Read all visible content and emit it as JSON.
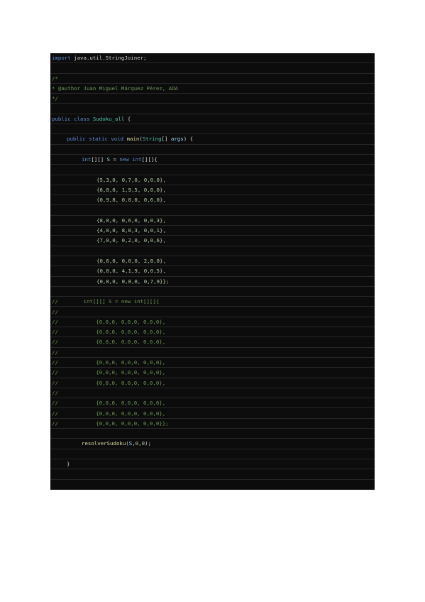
{
  "document": {
    "lines": [
      {
        "indent": 0,
        "parts": [
          {
            "t": "import",
            "c": "kw"
          },
          {
            "t": " ",
            "c": "pl"
          },
          {
            "t": "java.util.StringJoiner;",
            "c": "pl"
          }
        ]
      },
      {
        "indent": 0,
        "parts": []
      },
      {
        "indent": 0,
        "parts": [
          {
            "t": "/*",
            "c": "cm"
          }
        ]
      },
      {
        "indent": 0,
        "parts": [
          {
            "t": "* @author Juan Miguel Márquez Pérez, ADA",
            "c": "cm"
          }
        ]
      },
      {
        "indent": 0,
        "parts": [
          {
            "t": "*/",
            "c": "cm"
          }
        ]
      },
      {
        "indent": 0,
        "parts": []
      },
      {
        "indent": 0,
        "parts": [
          {
            "t": "public",
            "c": "kw"
          },
          {
            "t": " ",
            "c": "pl"
          },
          {
            "t": "class",
            "c": "kw"
          },
          {
            "t": " ",
            "c": "pl"
          },
          {
            "t": "Sudoku_all",
            "c": "ty"
          },
          {
            "t": " {",
            "c": "pl"
          }
        ]
      },
      {
        "indent": 0,
        "parts": []
      },
      {
        "indent": 1,
        "parts": [
          {
            "t": "public",
            "c": "kw"
          },
          {
            "t": " ",
            "c": "pl"
          },
          {
            "t": "static",
            "c": "kw"
          },
          {
            "t": " ",
            "c": "pl"
          },
          {
            "t": "void",
            "c": "kw"
          },
          {
            "t": " ",
            "c": "pl"
          },
          {
            "t": "main",
            "c": "fn"
          },
          {
            "t": "(",
            "c": "pl"
          },
          {
            "t": "String",
            "c": "ty"
          },
          {
            "t": "[] ",
            "c": "pl"
          },
          {
            "t": "args",
            "c": "pa"
          },
          {
            "t": ") {",
            "c": "pl"
          }
        ]
      },
      {
        "indent": 0,
        "parts": []
      },
      {
        "indent": 2,
        "parts": [
          {
            "t": "int",
            "c": "kw"
          },
          {
            "t": "[][] ",
            "c": "pl"
          },
          {
            "t": "S",
            "c": "pa"
          },
          {
            "t": " = ",
            "c": "pl"
          },
          {
            "t": "new",
            "c": "kw"
          },
          {
            "t": " ",
            "c": "pl"
          },
          {
            "t": "int",
            "c": "kw"
          },
          {
            "t": "[][]{",
            "c": "pl"
          }
        ]
      },
      {
        "indent": 0,
        "parts": []
      },
      {
        "indent": 3,
        "parts": [
          {
            "t": "{5,3,0, 0,7,0, 0,0,0},",
            "c": "nu"
          }
        ]
      },
      {
        "indent": 3,
        "parts": [
          {
            "t": "{6,0,0, 1,9,5, 0,0,0},",
            "c": "nu"
          }
        ]
      },
      {
        "indent": 3,
        "parts": [
          {
            "t": "{0,9,8, 0,0,0, 0,6,0},",
            "c": "nu"
          }
        ]
      },
      {
        "indent": 0,
        "parts": []
      },
      {
        "indent": 3,
        "parts": [
          {
            "t": "{8,0,0, 0,6,0, 0,0,3},",
            "c": "nu"
          }
        ]
      },
      {
        "indent": 3,
        "parts": [
          {
            "t": "{4,0,0, 8,0,3, 0,0,1},",
            "c": "nu"
          }
        ]
      },
      {
        "indent": 3,
        "parts": [
          {
            "t": "{7,0,0, 0,2,0, 0,0,6},",
            "c": "nu"
          }
        ]
      },
      {
        "indent": 0,
        "parts": []
      },
      {
        "indent": 3,
        "parts": [
          {
            "t": "{0,6,0, 0,0,0, 2,8,0},",
            "c": "nu"
          }
        ]
      },
      {
        "indent": 3,
        "parts": [
          {
            "t": "{0,0,0, 4,1,9, 0,0,5},",
            "c": "nu"
          }
        ]
      },
      {
        "indent": 3,
        "parts": [
          {
            "t": "{0,0,0, 0,8,0, 0,7,9}};",
            "c": "nu"
          }
        ]
      },
      {
        "indent": 0,
        "parts": []
      },
      {
        "indent": 0,
        "parts": [
          {
            "t": "//        int[][] S = new int[][]{",
            "c": "cm"
          }
        ]
      },
      {
        "indent": 0,
        "parts": [
          {
            "t": "//",
            "c": "cm"
          }
        ]
      },
      {
        "indent": 0,
        "parts": [
          {
            "t": "//            {0,0,0, 0,0,0, 0,0,0},",
            "c": "cm"
          }
        ]
      },
      {
        "indent": 0,
        "parts": [
          {
            "t": "//            {0,0,0, 0,0,0, 0,0,0},",
            "c": "cm"
          }
        ]
      },
      {
        "indent": 0,
        "parts": [
          {
            "t": "//            {0,0,0, 0,0,0, 0,0,0},",
            "c": "cm"
          }
        ]
      },
      {
        "indent": 0,
        "parts": [
          {
            "t": "//",
            "c": "cm"
          }
        ]
      },
      {
        "indent": 0,
        "parts": [
          {
            "t": "//            {0,0,0, 0,0,0, 0,0,0},",
            "c": "cm"
          }
        ]
      },
      {
        "indent": 0,
        "parts": [
          {
            "t": "//            {0,0,0, 0,0,0, 0,0,0},",
            "c": "cm"
          }
        ]
      },
      {
        "indent": 0,
        "parts": [
          {
            "t": "//            {0,0,0, 0,0,0, 0,0,0},",
            "c": "cm"
          }
        ]
      },
      {
        "indent": 0,
        "parts": [
          {
            "t": "//",
            "c": "cm"
          }
        ]
      },
      {
        "indent": 0,
        "parts": [
          {
            "t": "//            {0,0,0, 0,0,0, 0,0,0},",
            "c": "cm"
          }
        ]
      },
      {
        "indent": 0,
        "parts": [
          {
            "t": "//            {0,0,0, 0,0,0, 0,0,0},",
            "c": "cm"
          }
        ]
      },
      {
        "indent": 0,
        "parts": [
          {
            "t": "//            {0,0,0, 0,0,0, 0,0,0}};",
            "c": "cm"
          }
        ]
      },
      {
        "indent": 0,
        "parts": []
      },
      {
        "indent": 2,
        "parts": [
          {
            "t": "resolverSudoku",
            "c": "fn"
          },
          {
            "t": "(",
            "c": "pl"
          },
          {
            "t": "S",
            "c": "pa"
          },
          {
            "t": ",",
            "c": "pl"
          },
          {
            "t": "0",
            "c": "nu"
          },
          {
            "t": ",",
            "c": "pl"
          },
          {
            "t": "0",
            "c": "nu"
          },
          {
            "t": ");",
            "c": "pl"
          }
        ]
      },
      {
        "indent": 0,
        "parts": []
      },
      {
        "indent": 1,
        "parts": [
          {
            "t": "}",
            "c": "pl"
          }
        ]
      },
      {
        "indent": 0,
        "parts": []
      },
      {
        "indent": 0,
        "parts": []
      }
    ]
  }
}
